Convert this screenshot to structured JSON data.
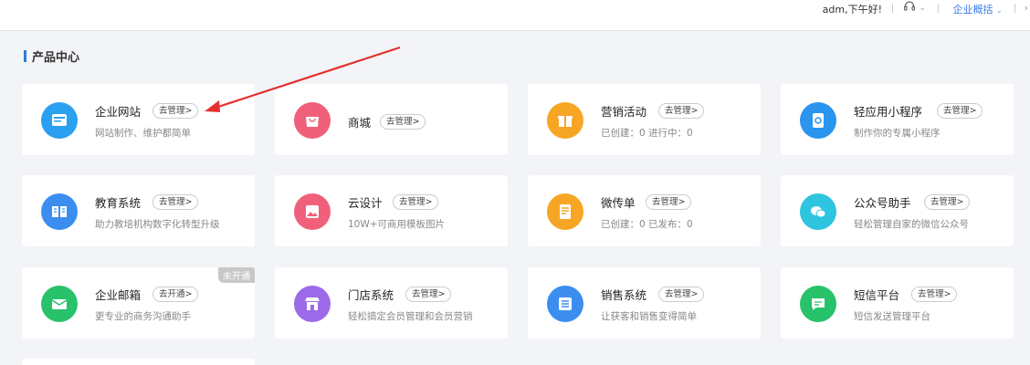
{
  "header": {
    "greeting": "adm,下午好!",
    "headset_icon": "headset-icon",
    "org_label": "企业概括",
    "more": "›"
  },
  "section": {
    "title": "产品中心"
  },
  "products": [
    {
      "title": "企业网站",
      "action": "去管理>",
      "desc": "网站制作、维护都简单",
      "icon": "website-icon",
      "color": "#2aa0f0"
    },
    {
      "title": "商城",
      "action": "去管理>",
      "desc": "",
      "icon": "shop-bag-icon",
      "color": "#f0607a"
    },
    {
      "title": "营销活动",
      "action": "去管理>",
      "desc": "已创建：0    进行中：0",
      "icon": "gift-icon",
      "color": "#f6a624"
    },
    {
      "title": "轻应用小程序",
      "action": "去管理>",
      "desc": "制作你的专属小程序",
      "icon": "mini-app-icon",
      "color": "#2a95ee"
    },
    {
      "title": "教育系统",
      "action": "去管理>",
      "desc": "助力教培机构数字化转型升级",
      "icon": "book-icon",
      "color": "#3b8ef0"
    },
    {
      "title": "云设计",
      "action": "去管理>",
      "desc": "10W+可商用模板图片",
      "icon": "image-icon",
      "color": "#f0607a"
    },
    {
      "title": "微传单",
      "action": "去管理>",
      "desc": "已创建：0    已发布：0",
      "icon": "flyer-icon",
      "color": "#f6a624"
    },
    {
      "title": "公众号助手",
      "action": "去管理>",
      "desc": "轻松管理自家的微信公众号",
      "icon": "wechat-icon",
      "color": "#2fc4e0"
    },
    {
      "title": "企业邮箱",
      "action": "去开通>",
      "desc": "更专业的商务沟通助手",
      "icon": "mail-icon",
      "color": "#28c26a",
      "badge": "未开通"
    },
    {
      "title": "门店系统",
      "action": "去管理>",
      "desc": "轻松搞定会员管理和会员营销",
      "icon": "store-icon",
      "color": "#9b6ae8"
    },
    {
      "title": "销售系统",
      "action": "去管理>",
      "desc": "让获客和销售变得简单",
      "icon": "list-icon",
      "color": "#3b8ef0"
    },
    {
      "title": "短信平台",
      "action": "去管理>",
      "desc": "短信发送管理平台",
      "icon": "sms-icon",
      "color": "#28c26a"
    }
  ]
}
